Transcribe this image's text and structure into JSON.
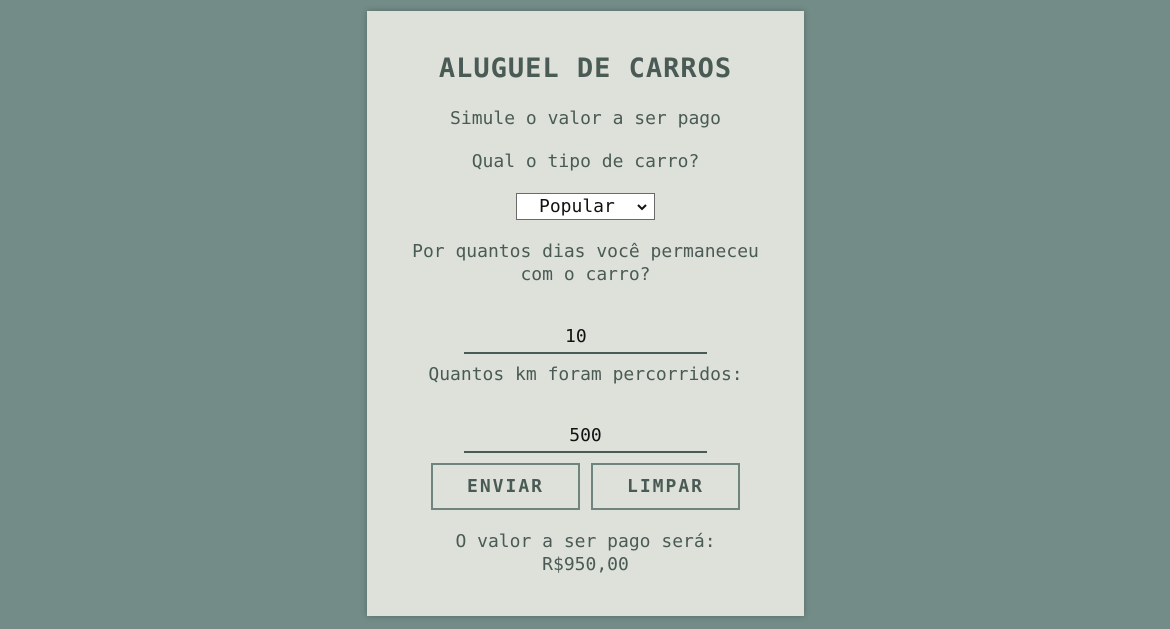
{
  "form": {
    "title": "ALUGUEL DE CARROS",
    "subtitle": "Simule o valor a ser pago",
    "car_type_question": "Qual o tipo de carro?",
    "car_type_selected": "Popular",
    "days_question": "Por quantos dias você permaneceu com o carro?",
    "days_value": "10",
    "km_question": "Quantos km foram percorridos:",
    "km_value": "500",
    "send_label": "ENVIAR",
    "clear_label": "LIMPAR",
    "result_label": "O valor a ser pago será:",
    "result_value": "R$950,00"
  },
  "colors": {
    "background": "#738c87",
    "card": "#dde1da",
    "text": "#4a5a54"
  },
  "icons": {
    "select_arrow": "chevron-down-icon"
  }
}
